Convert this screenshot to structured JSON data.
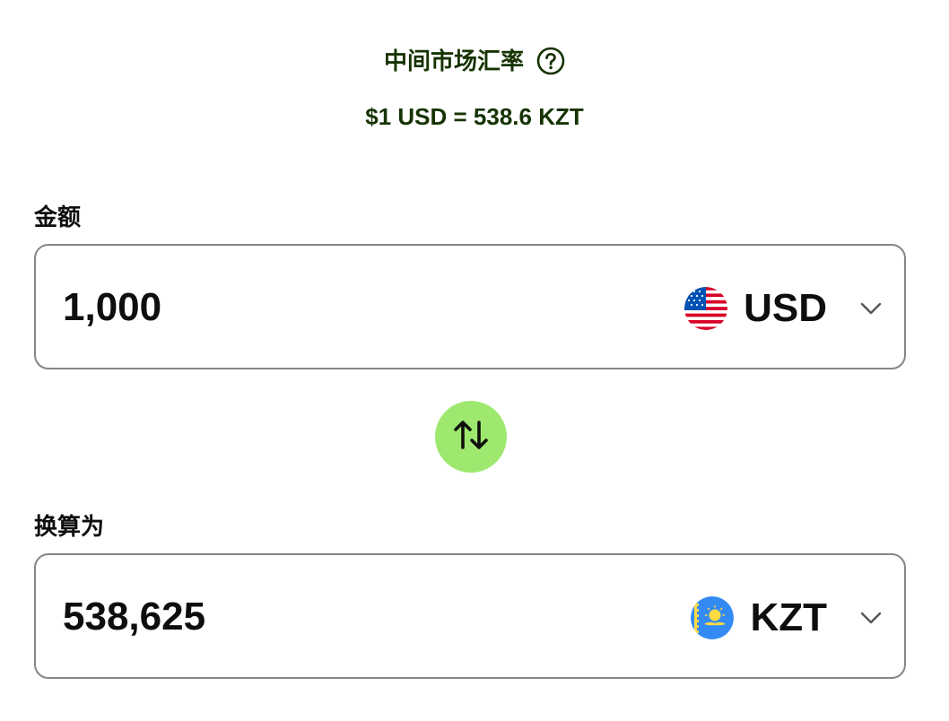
{
  "rate": {
    "title": "中间市场汇率",
    "value": "$1 USD = 538.6 KZT"
  },
  "amount": {
    "label": "金额",
    "value": "1,000",
    "currency": {
      "code": "USD",
      "flag_icon": "us-flag-icon"
    }
  },
  "convert": {
    "label": "换算为",
    "value": "538,625",
    "currency": {
      "code": "KZT",
      "flag_icon": "kz-flag-icon"
    }
  },
  "colors": {
    "accent_green": "#9fe870",
    "dark_green_text": "#163300",
    "border": "#868685",
    "text": "#0e0f0c"
  }
}
